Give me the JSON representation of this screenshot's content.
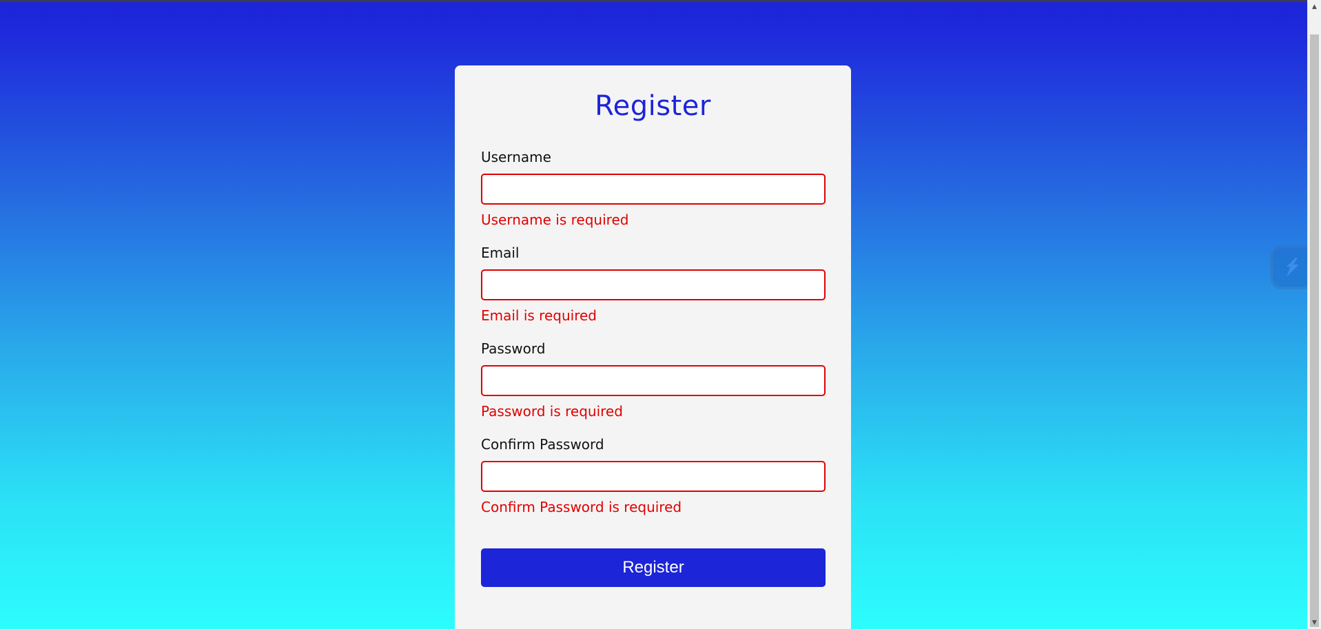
{
  "form": {
    "title": "Register",
    "fields": [
      {
        "label": "Username",
        "value": "",
        "error": "Username is required"
      },
      {
        "label": "Email",
        "value": "",
        "error": "Email is required"
      },
      {
        "label": "Password",
        "value": "",
        "error": "Password is required"
      },
      {
        "label": "Confirm Password",
        "value": "",
        "error": "Confirm Password is required"
      }
    ],
    "submit_label": "Register"
  },
  "colors": {
    "accent": "#1c25d8",
    "error": "#e00000",
    "card_background": "#f4f4f4",
    "gradient_top": "#1c25d8",
    "gradient_bottom": "#2cfdfd"
  },
  "icons": {
    "side_widget": "lightning-bolt-icon",
    "scroll_up": "triangle-up-icon",
    "scroll_down": "triangle-down-icon"
  }
}
